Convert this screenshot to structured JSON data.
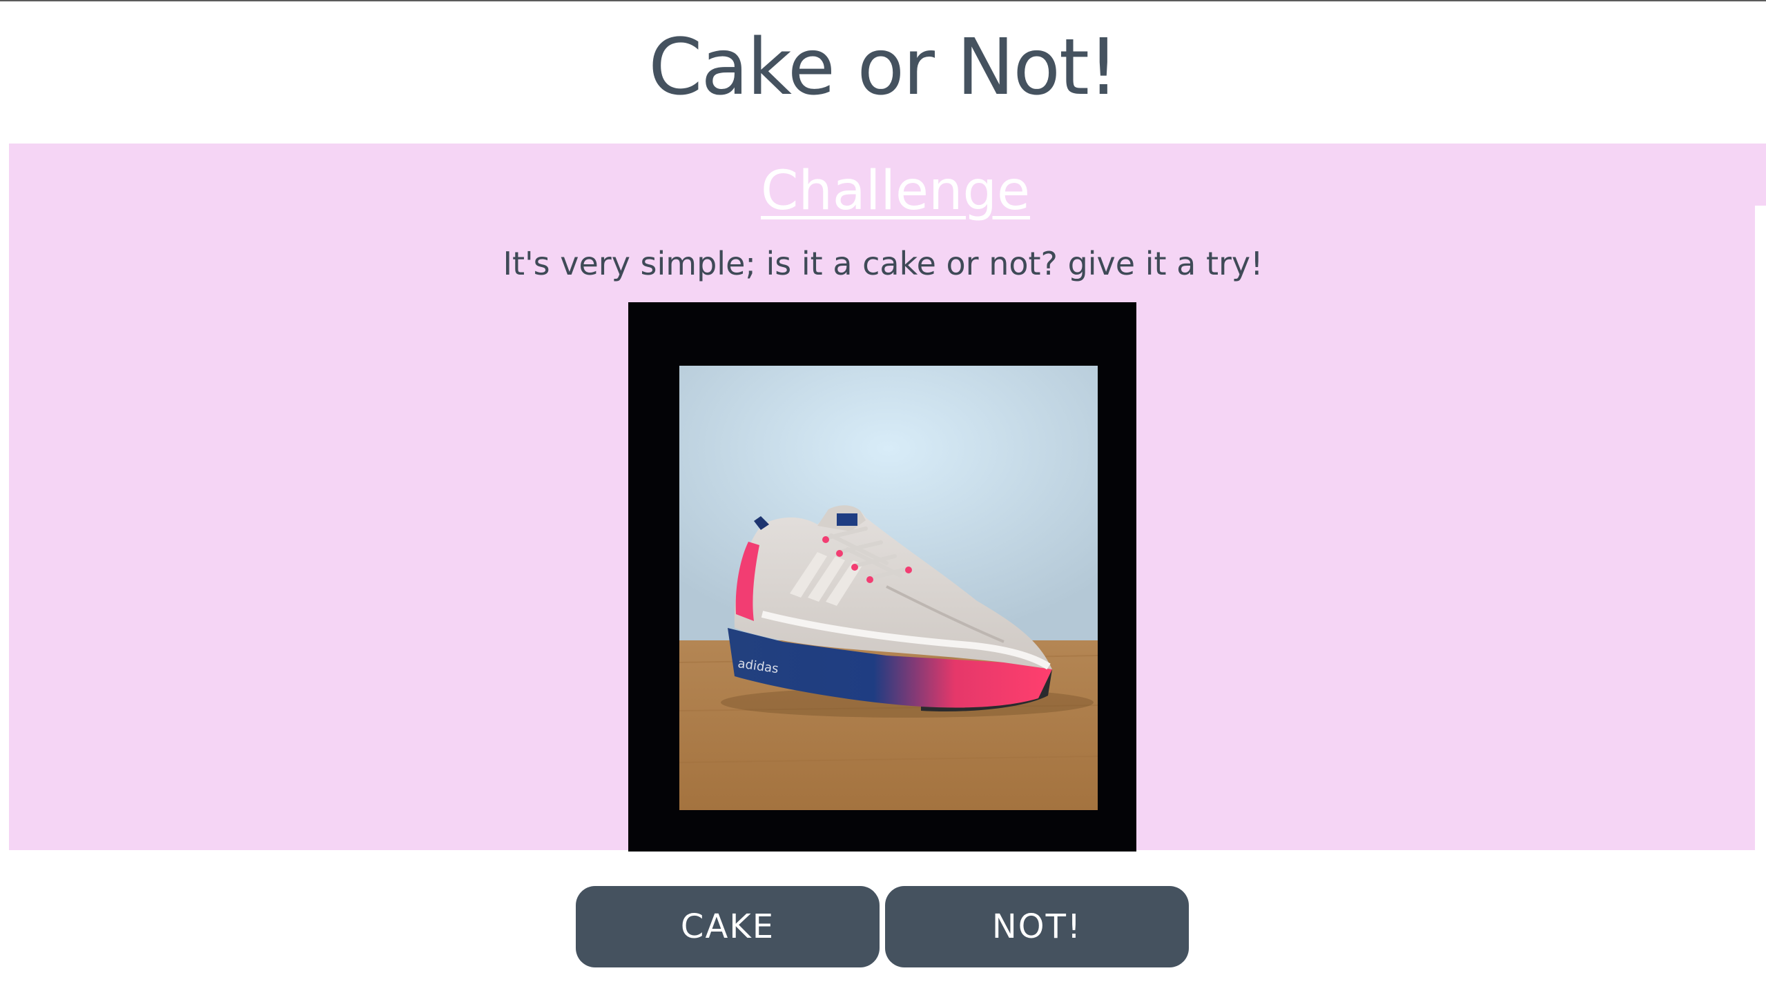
{
  "header": {
    "title": "Cake or Not!"
  },
  "challenge": {
    "heading": "Challenge",
    "description": "It's very simple; is it a cake or not? give it a try!",
    "image": {
      "brand_text": "adidas"
    }
  },
  "actions": {
    "cake_label": "CAKE",
    "not_label": "NOT!"
  },
  "colors": {
    "title_text": "#45525f",
    "panel_background": "#f5d5f5",
    "button_background": "#45525f",
    "button_text": "#ffffff",
    "heading_text": "#ffffff",
    "frame": "#030306"
  }
}
